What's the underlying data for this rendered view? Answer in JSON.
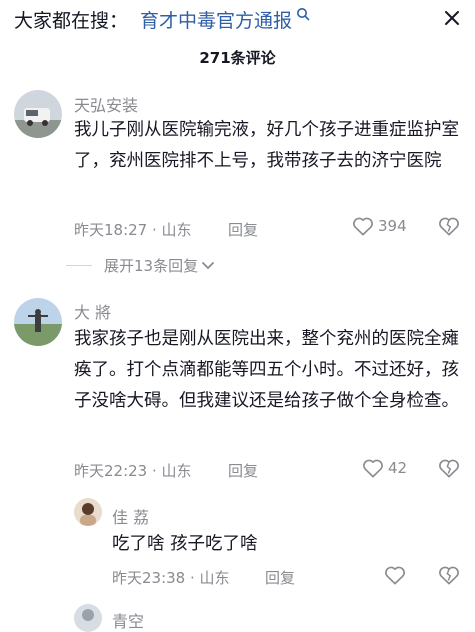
{
  "search": {
    "prefix": "大家都在搜：",
    "query": "育才中毒官方通报",
    "icon": "search-icon"
  },
  "comments_count": "271条评论",
  "comments": [
    {
      "username": "天弘安装",
      "text": "我儿子刚从医院输完液，好几个孩子进重症监护室了，兖州医院排不上号，我带孩子去的济宁医院",
      "time": "昨天18:27",
      "location": "山东",
      "reply_label": "回复",
      "likes": "394",
      "expand_label": "展开13条回复"
    },
    {
      "username": "大 將",
      "text": "我家孩子也是刚从医院出来，整个兖州的医院全瘫痪了。打个点滴都能等四五个小时。不过还好，孩子没啥大碍。但我建议还是给孩子做个全身检查。",
      "time": "昨天22:23",
      "location": "山东",
      "reply_label": "回复",
      "likes": "42",
      "replies": [
        {
          "username": "佳 荔",
          "text": "吃了啥 孩子吃了啥",
          "time": "昨天23:38",
          "location": "山东",
          "reply_label": "回复"
        }
      ]
    },
    {
      "username": "青空"
    }
  ]
}
